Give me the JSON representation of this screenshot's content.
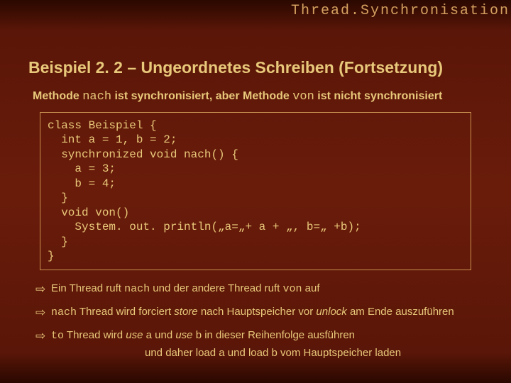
{
  "header": {
    "topic": "Thread.Synchronisation"
  },
  "title": "Beispiel 2. 2 – Ungeordnetes Schreiben (Fortsetzung)",
  "subtitle": {
    "p1": "Methode ",
    "m1": "nach",
    "p2": " ist synchronisiert, aber Methode ",
    "m2": "von",
    "p3": " ist nicht synchronisiert"
  },
  "code": "class Beispiel {\n  int a = 1, b = 2;\n  synchronized void nach() {\n    a = 3;\n    b = 4;\n  }\n  void von()\n    System. out. println(„a=„+ a + „, b=„ +b);\n  }\n}",
  "bullets": [
    {
      "p1": "Ein Thread ruft ",
      "m1": "nach",
      "p2": " und der andere Thread ruft ",
      "m2": "von",
      "p3": " auf"
    },
    {
      "m1": "nach",
      "p1": " Thread wird forciert ",
      "i1": "store",
      "p2": " nach Hauptspeicher vor ",
      "i2": "unlock",
      "p3": " am Ende auszuführen"
    },
    {
      "m1": "to",
      "p1": " Thread wird  ",
      "i1": "use",
      "p2": " a und ",
      "i2": "use",
      "p3": " b in dieser Reihenfolge ausführen",
      "cont_p1": "und daher ",
      "cont_i1": "load",
      "cont_p2": " a und ",
      "cont_i2": "load",
      "cont_p3": " b vom Hauptspeicher laden"
    }
  ],
  "arrow": "⇨"
}
